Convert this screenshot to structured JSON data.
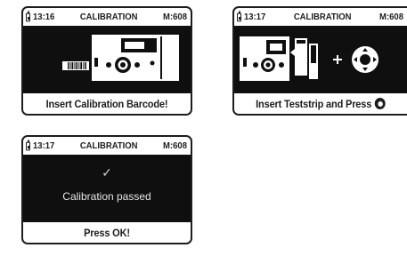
{
  "screens": [
    {
      "status": {
        "time": "13:16",
        "title": "CALIBRATION",
        "memory": "M:608"
      },
      "footer": "Insert Calibration Barcode!",
      "illustration": "barcode-into-meter"
    },
    {
      "status": {
        "time": "13:17",
        "title": "CALIBRATION",
        "memory": "M:608"
      },
      "footer": "Insert Teststrip and Press",
      "illustration": "teststrip-plus-button",
      "footer_icon": "ok-button-icon"
    },
    {
      "status": {
        "time": "13:17",
        "title": "CALIBRATION",
        "memory": "M:608"
      },
      "message": "Calibration passed",
      "check_glyph": "✓",
      "footer": "Press OK!"
    }
  ],
  "colors": {
    "screen_dark": "#0f0f0f",
    "ink": "#1d1d1b",
    "message_text": "#e6e6e6"
  }
}
